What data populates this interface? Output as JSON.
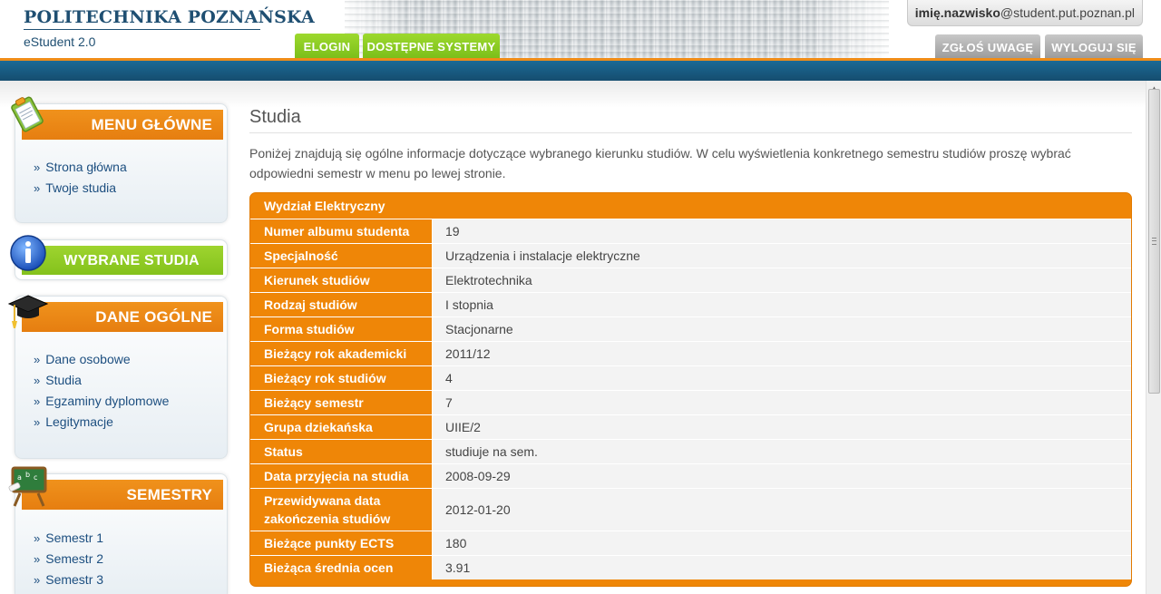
{
  "header": {
    "university": "POLITECHNIKA POZNAŃSKA",
    "app": "eStudent 2.0",
    "tabs": [
      "ELOGIN",
      "DOSTĘPNE SYSTEMY"
    ],
    "user_bold": "imię.nazwisko",
    "user_domain": "@student.put.poznan.pl",
    "report_button": "ZGŁOŚ UWAGĘ",
    "logout_button": "WYLOGUJ SIĘ"
  },
  "sidebar": {
    "menu": {
      "title": "MENU GŁÓWNE",
      "items": [
        "Strona główna",
        "Twoje studia"
      ]
    },
    "selected": {
      "title": "WYBRANE STUDIA"
    },
    "general": {
      "title": "DANE OGÓLNE",
      "items": [
        "Dane osobowe",
        "Studia",
        "Egzaminy dyplomowe",
        "Legitymacje"
      ]
    },
    "semesters": {
      "title": "SEMESTRY",
      "items": [
        "Semestr 1",
        "Semestr 2",
        "Semestr 3"
      ]
    },
    "bullet": "»"
  },
  "main": {
    "title": "Studia",
    "intro": "Poniżej znajdują się ogólne informacje dotyczące wybranego kierunku studiów. W celu wyświetlenia konkretnego semestru studiów proszę wybrać odpowiedni semestr w menu po lewej stronie.",
    "faculty": "Wydział Elektryczny",
    "rows": [
      {
        "label": "Numer albumu studenta",
        "value": "19"
      },
      {
        "label": "Specjalność",
        "value": "Urządzenia i instalacje elektryczne"
      },
      {
        "label": "Kierunek studiów",
        "value": "Elektrotechnika"
      },
      {
        "label": "Rodzaj studiów",
        "value": "I stopnia"
      },
      {
        "label": "Forma studiów",
        "value": "Stacjonarne"
      },
      {
        "label": "Bieżący rok akademicki",
        "value": "2011/12"
      },
      {
        "label": "Bieżący rok studiów",
        "value": "4"
      },
      {
        "label": "Bieżący semestr",
        "value": "7"
      },
      {
        "label": "Grupa dziekańska",
        "value": "UIIE/2"
      },
      {
        "label": "Status",
        "value": "studiuje na sem."
      },
      {
        "label": "Data przyjęcia na studia",
        "value": "2008-09-29"
      },
      {
        "label": "Przewidywana data zakończenia studiów",
        "value": "2012-01-20"
      },
      {
        "label": "Bieżące punkty ECTS",
        "value": "180"
      },
      {
        "label": "Bieżąca średnia ocen",
        "value": "3.91"
      }
    ]
  },
  "colors": {
    "accent_orange": "#ef8607",
    "accent_green": "#8cc724",
    "brand_blue": "#1c6a95"
  }
}
